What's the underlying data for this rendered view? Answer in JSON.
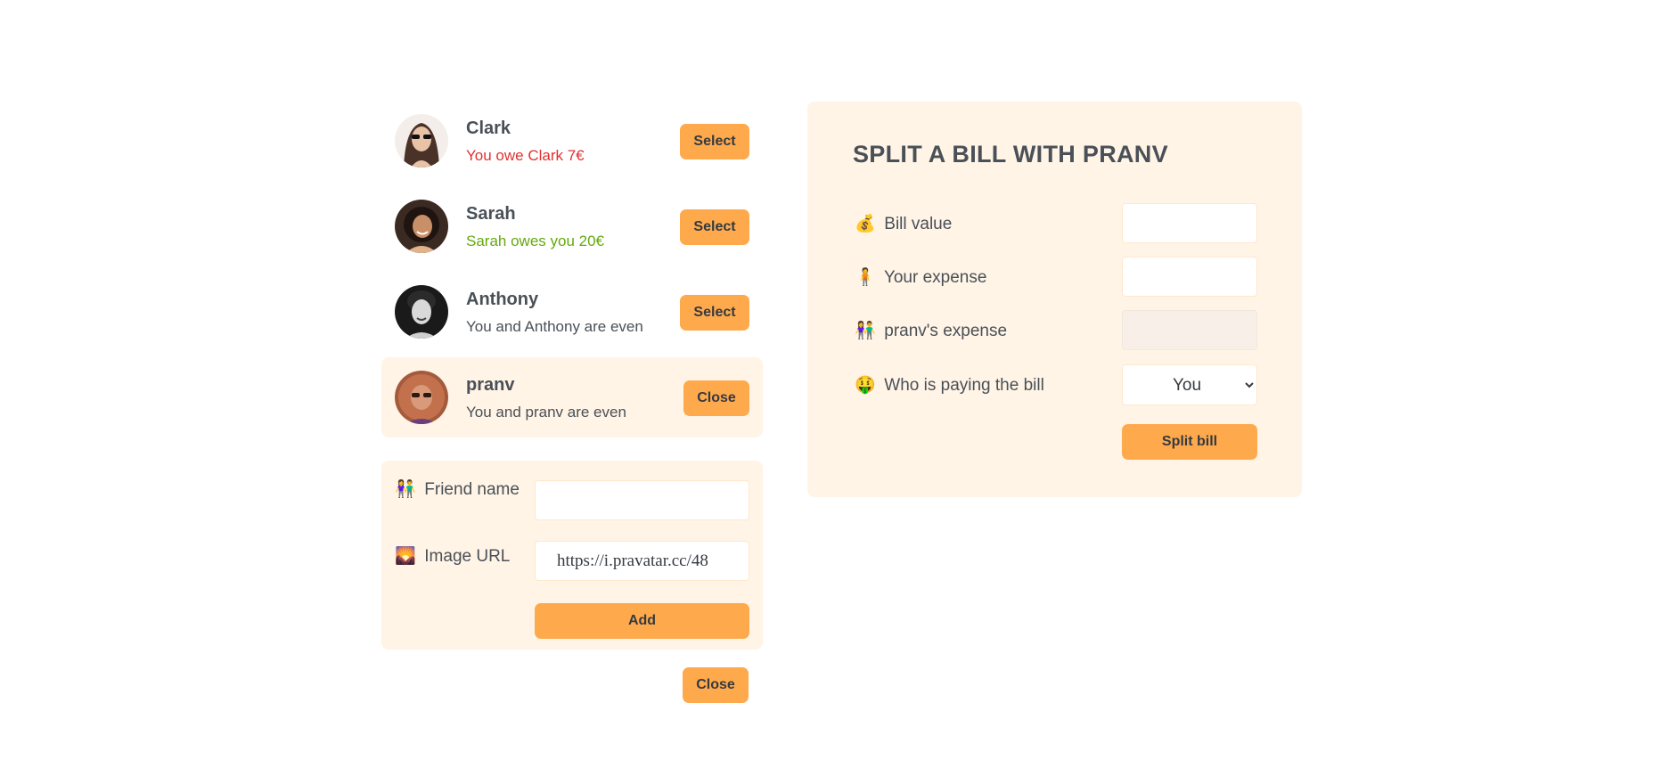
{
  "friends": [
    {
      "name": "Clark",
      "status": "You owe Clark 7€",
      "button": "Select"
    },
    {
      "name": "Sarah",
      "status": "Sarah owes you 20€",
      "button": "Select"
    },
    {
      "name": "Anthony",
      "status": "You and Anthony are even",
      "button": "Select"
    },
    {
      "name": "pranv",
      "status": "You and pranv are even",
      "button": "Close"
    }
  ],
  "add_friend": {
    "name_emoji": "👫",
    "name_label": "Friend name",
    "name_value": "",
    "url_emoji": "🌄",
    "url_label": "Image URL",
    "url_value": "https://i.pravatar.cc/48",
    "add_label": "Add"
  },
  "close_label": "Close",
  "split": {
    "title": "SPLIT A BILL WITH PRANV",
    "bill_emoji": "💰",
    "bill_label": "Bill value",
    "bill_value": "",
    "your_emoji": "🧍",
    "your_label": "Your expense",
    "your_value": "",
    "friend_emoji": "👫",
    "friend_label": "pranv's expense",
    "friend_value": "",
    "payer_emoji": "🤑",
    "payer_label": "Who is paying the bill",
    "payer_selected": "You",
    "split_label": "Split bill"
  },
  "colors": {
    "accent": "#ffa94d",
    "panel": "#fff4e6",
    "owe": "#e03131",
    "owed": "#66a80f"
  }
}
